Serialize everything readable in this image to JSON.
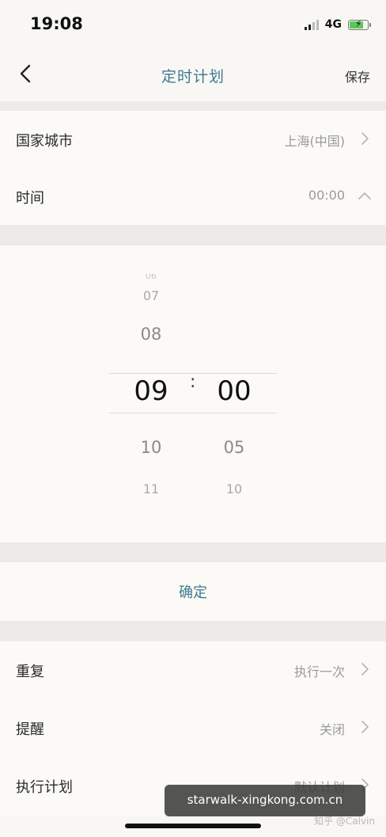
{
  "status_bar": {
    "time": "19:08",
    "network": "4G"
  },
  "nav": {
    "title": "定时计划",
    "save_label": "保存"
  },
  "settings_top": [
    {
      "label": "国家城市",
      "value": "上海(中国)",
      "arrow": "chevron-right"
    },
    {
      "label": "时间",
      "value": "00:00",
      "arrow": "chevron-up"
    }
  ],
  "time_picker": {
    "hours": [
      "07",
      "08",
      "09",
      "10",
      "11"
    ],
    "minutes": [
      "00",
      "05",
      "10"
    ],
    "selected_hour": "09",
    "selected_minute": "00",
    "separator": ":"
  },
  "confirm_label": "确定",
  "settings_bottom": [
    {
      "label": "重复",
      "value": "执行一次"
    },
    {
      "label": "提醒",
      "value": "关闭"
    },
    {
      "label": "执行计划",
      "value": "默认计划"
    }
  ],
  "watermark": "starwalk-xingkong.com.cn",
  "credit": "知乎 @Calvin",
  "colors": {
    "accent": "#3f7a8e",
    "background": "#f8f7f4",
    "divider_band": "#ecebe8"
  }
}
